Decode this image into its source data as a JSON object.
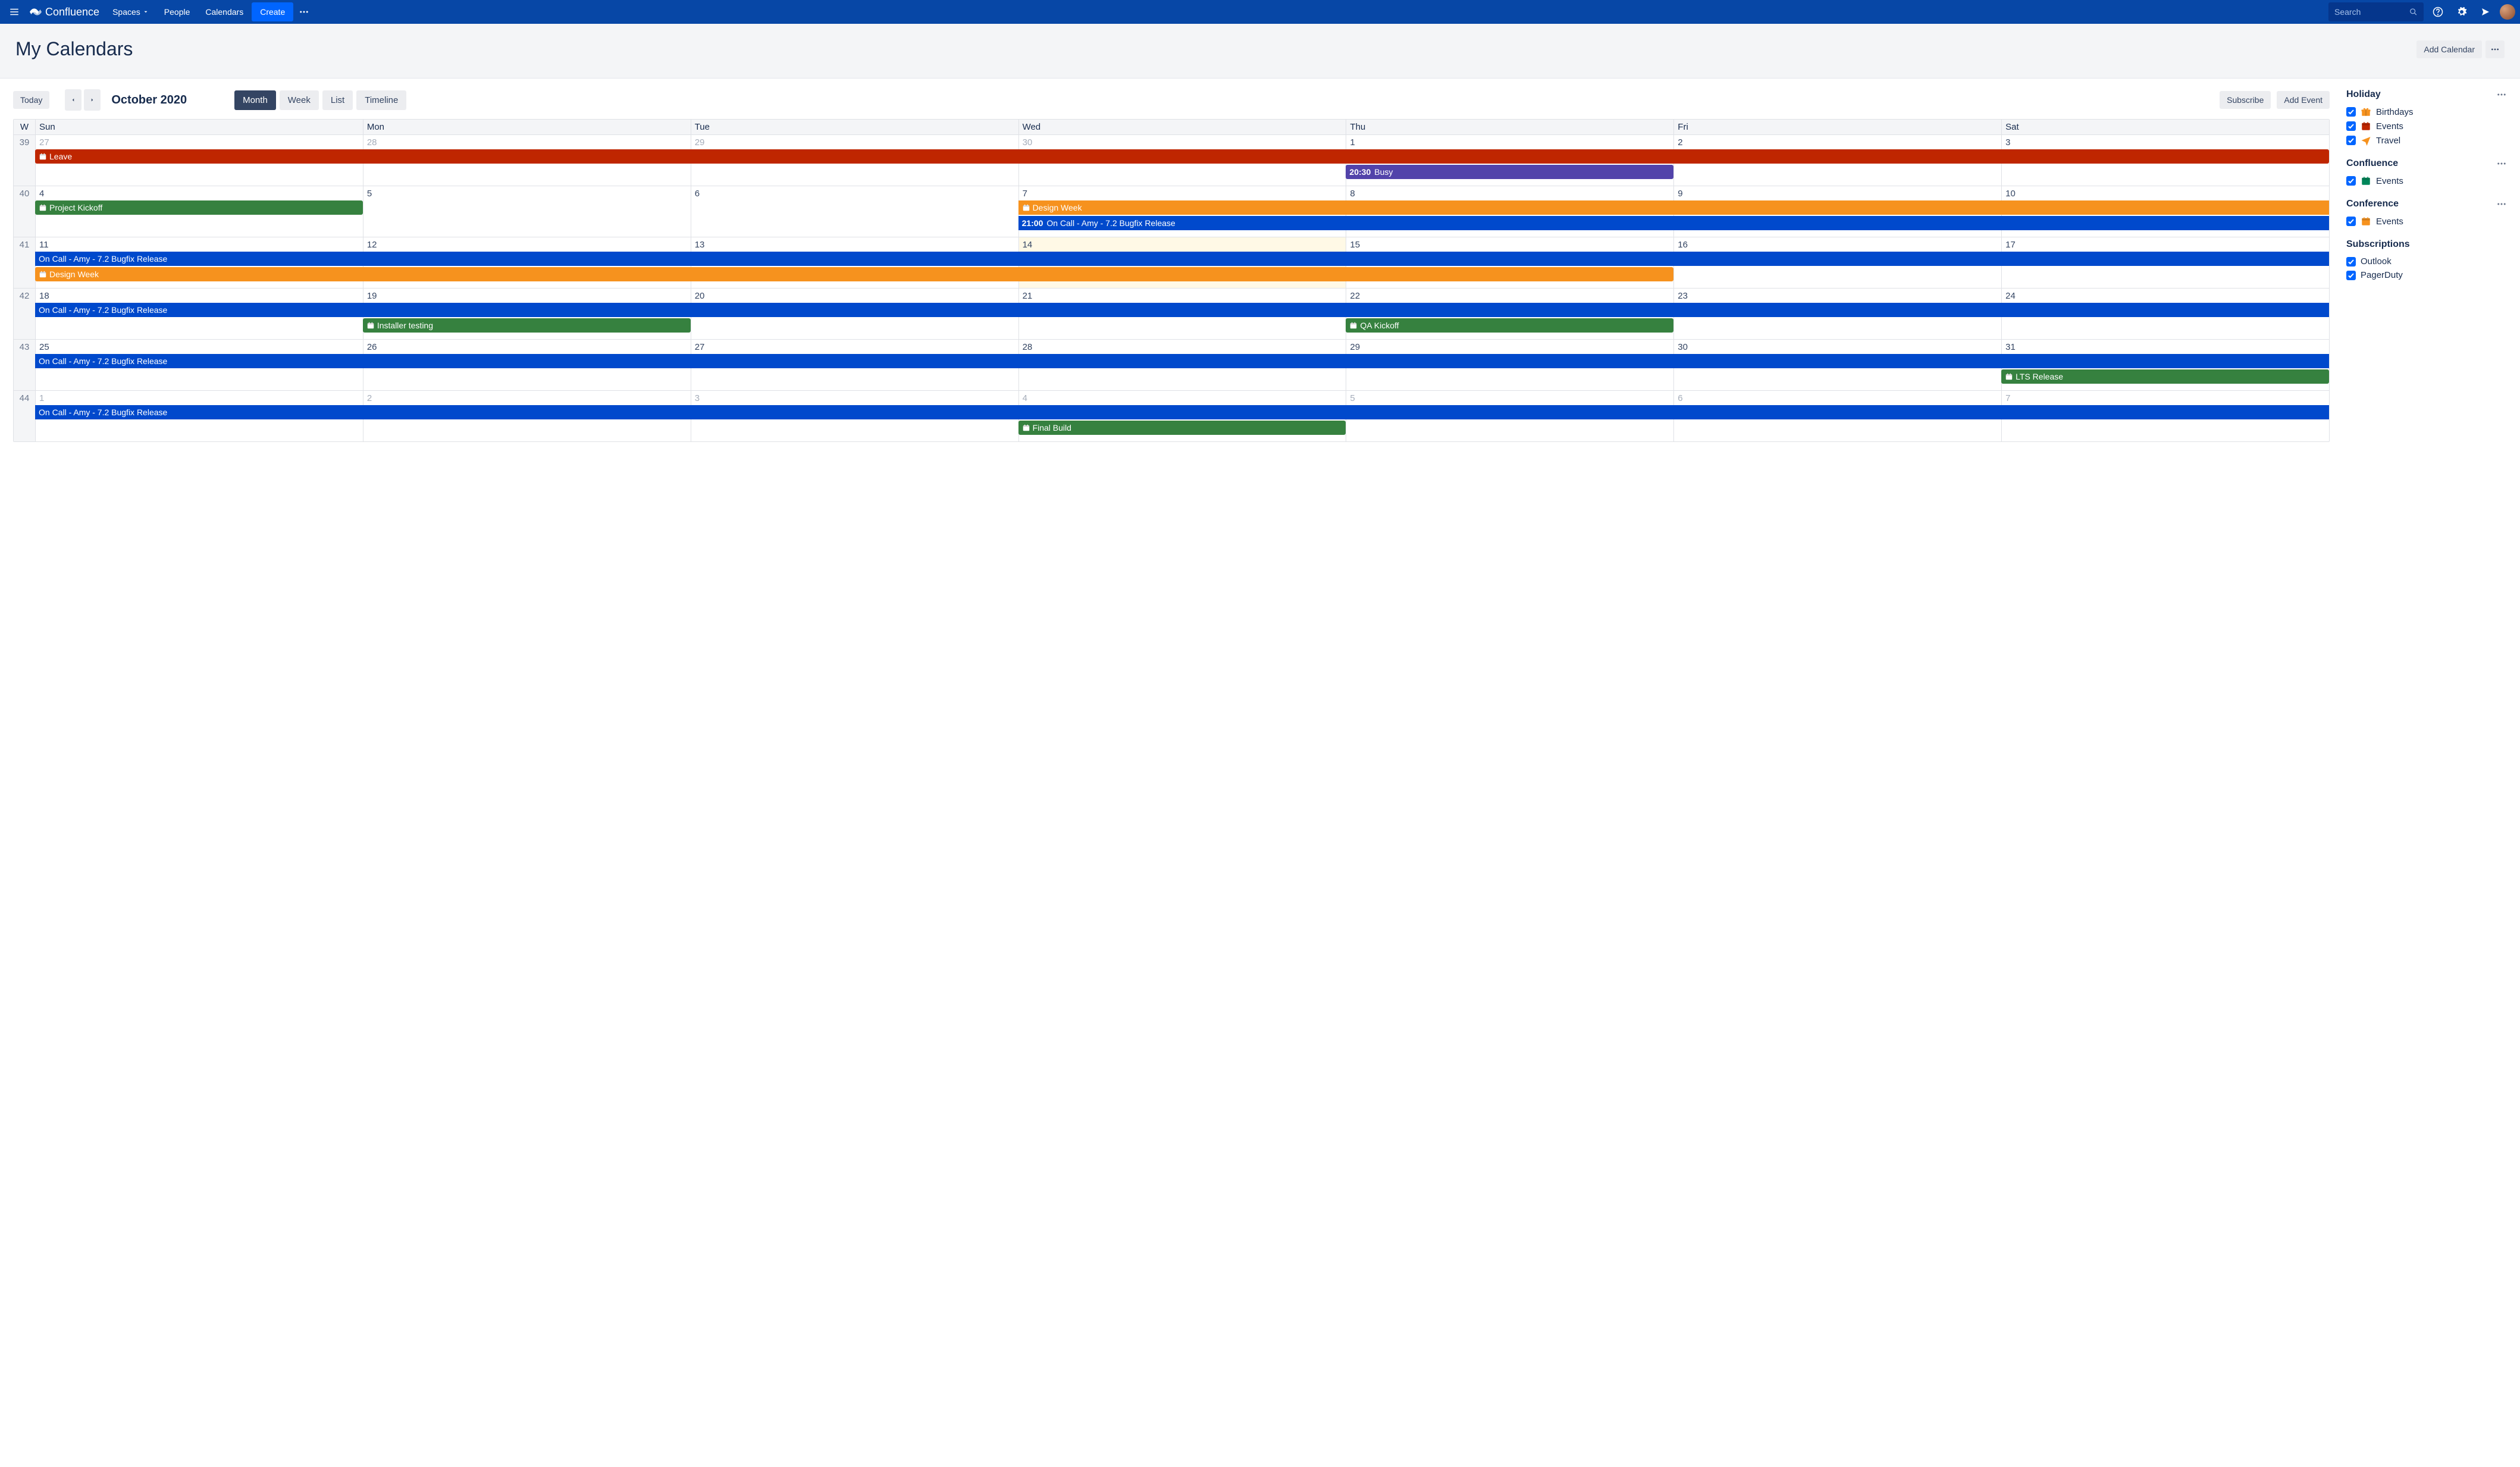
{
  "nav": {
    "product": "Confluence",
    "links": {
      "spaces": "Spaces",
      "people": "People",
      "calendars": "Calendars"
    },
    "create": "Create",
    "search_placeholder": "Search"
  },
  "page": {
    "title": "My Calendars",
    "add_calendar": "Add Calendar"
  },
  "toolbar": {
    "today": "Today",
    "month_label": "October 2020",
    "views": {
      "month": "Month",
      "week": "Week",
      "list": "List",
      "timeline": "Timeline"
    },
    "subscribe": "Subscribe",
    "add_event": "Add Event"
  },
  "calendar": {
    "week_header": "W",
    "day_headers": [
      "Sun",
      "Mon",
      "Tue",
      "Wed",
      "Thu",
      "Fri",
      "Sat"
    ],
    "weeks": [
      {
        "num": "39",
        "days": [
          {
            "n": "27",
            "other": true
          },
          {
            "n": "28",
            "other": true
          },
          {
            "n": "29",
            "other": true
          },
          {
            "n": "30",
            "other": true
          },
          {
            "n": "1"
          },
          {
            "n": "2"
          },
          {
            "n": "3"
          }
        ],
        "events": [
          {
            "row": 0,
            "start": 0,
            "span": 7,
            "color": "c-red",
            "label": "Leave",
            "icon": true,
            "rounded": true
          },
          {
            "row": 1,
            "start": 4,
            "span": 1,
            "color": "c-purple",
            "time": "20:30",
            "label": "Busy",
            "rounded": true
          }
        ]
      },
      {
        "num": "40",
        "days": [
          {
            "n": "4"
          },
          {
            "n": "5"
          },
          {
            "n": "6"
          },
          {
            "n": "7"
          },
          {
            "n": "8"
          },
          {
            "n": "9"
          },
          {
            "n": "10"
          }
        ],
        "events": [
          {
            "row": 0,
            "start": 0,
            "span": 1,
            "color": "c-green",
            "label": "Project Kickoff",
            "icon": true,
            "rounded": true
          },
          {
            "row": 0,
            "start": 3,
            "span": 4,
            "color": "c-orange",
            "label": "Design Week",
            "icon": true
          },
          {
            "row": 1,
            "start": 3,
            "span": 4,
            "color": "c-blue",
            "time": "21:00",
            "label": "On Call - Amy - 7.2 Bugfix Release"
          }
        ]
      },
      {
        "num": "41",
        "days": [
          {
            "n": "11"
          },
          {
            "n": "12"
          },
          {
            "n": "13"
          },
          {
            "n": "14",
            "today": true
          },
          {
            "n": "15"
          },
          {
            "n": "16"
          },
          {
            "n": "17"
          }
        ],
        "events": [
          {
            "row": 0,
            "start": 0,
            "span": 7,
            "color": "c-blue",
            "label": "On Call - Amy - 7.2 Bugfix Release"
          },
          {
            "row": 1,
            "start": 0,
            "span": 5,
            "color": "c-orange",
            "label": "Design Week",
            "icon": true,
            "rounded": true
          }
        ]
      },
      {
        "num": "42",
        "days": [
          {
            "n": "18"
          },
          {
            "n": "19"
          },
          {
            "n": "20"
          },
          {
            "n": "21"
          },
          {
            "n": "22"
          },
          {
            "n": "23"
          },
          {
            "n": "24"
          }
        ],
        "events": [
          {
            "row": 0,
            "start": 0,
            "span": 7,
            "color": "c-blue",
            "label": "On Call - Amy - 7.2 Bugfix Release"
          },
          {
            "row": 1,
            "start": 1,
            "span": 1,
            "color": "c-green",
            "label": "Installer testing",
            "icon": true,
            "rounded": true
          },
          {
            "row": 1,
            "start": 4,
            "span": 1,
            "color": "c-green",
            "label": "QA Kickoff",
            "icon": true,
            "rounded": true
          }
        ]
      },
      {
        "num": "43",
        "days": [
          {
            "n": "25"
          },
          {
            "n": "26"
          },
          {
            "n": "27"
          },
          {
            "n": "28"
          },
          {
            "n": "29"
          },
          {
            "n": "30"
          },
          {
            "n": "31"
          }
        ],
        "events": [
          {
            "row": 0,
            "start": 0,
            "span": 7,
            "color": "c-blue",
            "label": "On Call - Amy - 7.2 Bugfix Release"
          },
          {
            "row": 1,
            "start": 6,
            "span": 1,
            "color": "c-green",
            "label": "LTS Release",
            "icon": true,
            "rounded": true
          }
        ]
      },
      {
        "num": "44",
        "days": [
          {
            "n": "1",
            "other": true
          },
          {
            "n": "2",
            "other": true
          },
          {
            "n": "3",
            "other": true
          },
          {
            "n": "4",
            "other": true
          },
          {
            "n": "5",
            "other": true
          },
          {
            "n": "6",
            "other": true
          },
          {
            "n": "7",
            "other": true
          }
        ],
        "events": [
          {
            "row": 0,
            "start": 0,
            "span": 7,
            "color": "c-blue",
            "label": "On Call - Amy - 7.2 Bugfix Release"
          },
          {
            "row": 1,
            "start": 3,
            "span": 1,
            "color": "c-green",
            "label": "Final Build",
            "icon": true,
            "rounded": true
          }
        ]
      }
    ]
  },
  "sidebar": {
    "groups": [
      {
        "title": "Holiday",
        "menu": true,
        "items": [
          {
            "icon": "gift",
            "color": "#F6921E",
            "label": "Birthdays"
          },
          {
            "icon": "cal",
            "color": "#BF2600",
            "label": "Events"
          },
          {
            "icon": "plane",
            "color": "#F6921E",
            "label": "Travel"
          }
        ]
      },
      {
        "title": "Confluence",
        "menu": true,
        "items": [
          {
            "icon": "cal",
            "color": "#00875A",
            "label": "Events"
          }
        ]
      },
      {
        "title": "Conference",
        "menu": true,
        "items": [
          {
            "icon": "cal",
            "color": "#F6921E",
            "label": "Events"
          }
        ]
      },
      {
        "title": "Subscriptions",
        "menu": false,
        "items": [
          {
            "icon": "none",
            "label": "Outlook"
          },
          {
            "icon": "none",
            "label": "PagerDuty"
          }
        ]
      }
    ]
  }
}
